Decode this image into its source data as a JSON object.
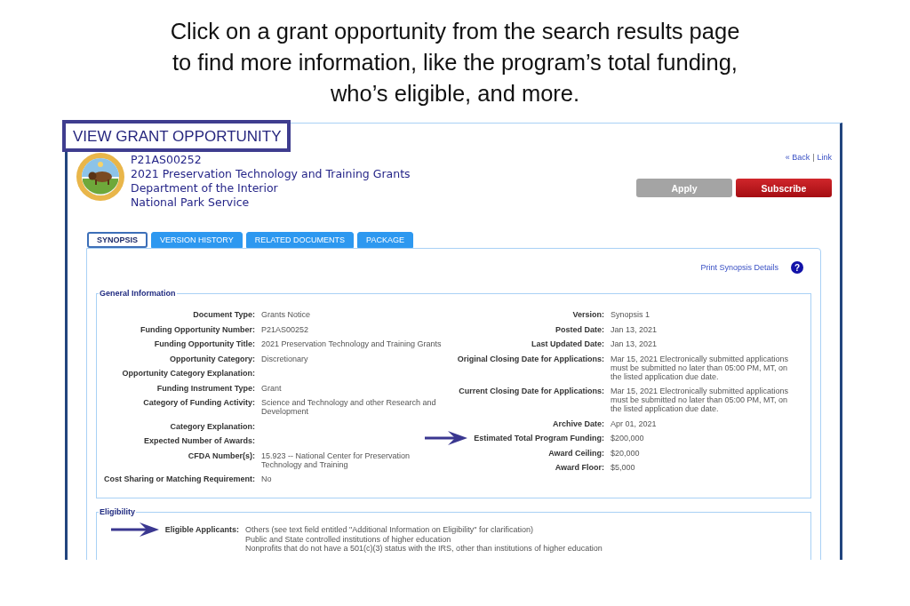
{
  "caption": [
    "Click on a grant opportunity from the search results page",
    "to find more information, like the program’s total funding,",
    "who’s eligible, and more."
  ],
  "page_title": "VIEW GRANT OPPORTUNITY",
  "header": {
    "lines": [
      "P21AS00252",
      "2021 Preservation Technology and Training Grants",
      "Department of the Interior",
      "National Park Service"
    ]
  },
  "nav_links": [
    "« Back",
    "Link"
  ],
  "nav_separator": "|",
  "buttons": [
    {
      "label": "Apply",
      "disabled": true
    },
    {
      "label": "Subscribe",
      "disabled": false
    }
  ],
  "tabs": [
    {
      "label": "SYNOPSIS",
      "selected": true
    },
    {
      "label": "VERSION HISTORY",
      "selected": false
    },
    {
      "label": "RELATED DOCUMENTS",
      "selected": false
    },
    {
      "label": "PACKAGE",
      "selected": false
    }
  ],
  "print_link": "Print Synopsis Details",
  "help_icon": "?",
  "general_information": {
    "legend": "General Information",
    "left": [
      {
        "label": "Document Type:",
        "value": "Grants Notice",
        "arrow": false
      },
      {
        "label": "Funding Opportunity Number:",
        "value": "P21AS00252",
        "arrow": false
      },
      {
        "label": "Funding Opportunity Title:",
        "value": "2021 Preservation Technology and Training Grants",
        "arrow": false
      },
      {
        "label": "Opportunity Category:",
        "value": "Discretionary",
        "arrow": false
      },
      {
        "label": "Opportunity Category Explanation:",
        "arrow": false
      },
      {
        "label": "Funding Instrument Type:",
        "value": "Grant",
        "arrow": false
      },
      {
        "label": "Category of Funding Activity:",
        "value": "Science and Technology and other Research and Development",
        "arrow": false
      },
      {
        "label": "Category Explanation:",
        "arrow": false
      },
      {
        "label": "Expected Number of Awards:",
        "arrow": false
      },
      {
        "label": "CFDA Number(s):",
        "value": "15.923 -- National Center for Preservation Technology and Training",
        "arrow": false
      },
      {
        "label": "Cost Sharing or Matching Requirement:",
        "value": "No",
        "arrow": false
      }
    ],
    "right": [
      {
        "label": "Version:",
        "value": "Synopsis 1",
        "arrow": false
      },
      {
        "label": "Posted Date:",
        "value": "Jan 13, 2021",
        "arrow": false
      },
      {
        "label": "Last Updated Date:",
        "value": "Jan 13, 2021",
        "arrow": false
      },
      {
        "label": "Original Closing Date for Applications:",
        "value": "Mar 15, 2021  Electronically submitted applications must be submitted no later than 05:00 PM, MT, on the listed application due date.",
        "arrow": false
      },
      {
        "label": "Current Closing Date for Applications:",
        "value": "Mar 15, 2021  Electronically submitted applications must be submitted no later than 05:00 PM, MT, on the listed application due date.",
        "arrow": false
      },
      {
        "label": "Archive Date:",
        "value": "Apr 01, 2021",
        "arrow": false
      },
      {
        "label": "Estimated Total Program Funding:",
        "value": "$200,000",
        "arrow": true
      },
      {
        "label": "Award Ceiling:",
        "value": "$20,000",
        "arrow": false
      },
      {
        "label": "Award Floor:",
        "value": "$5,000",
        "arrow": false
      }
    ]
  },
  "eligibility": {
    "legend": "Eligibility",
    "rows": [
      {
        "label": "Eligible Applicants:",
        "arrow": true,
        "values": [
          "Others (see text field entitled \"Additional Information on Eligibility\" for clarification)",
          "Public and State controlled institutions of higher education",
          "Nonprofits that do not have a 501(c)(3) status with the IRS, other than institutions of higher education"
        ]
      }
    ]
  }
}
